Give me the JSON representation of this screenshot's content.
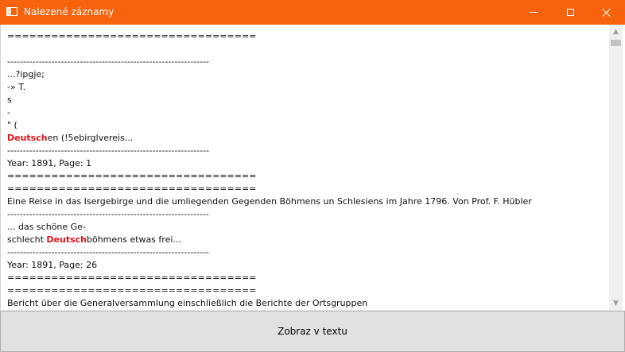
{
  "window": {
    "title": "Nalezené záznamy",
    "colors": {
      "titlebar": "#f7630c",
      "highlight": "#e8141c"
    },
    "controls": {
      "minimize": "minimize-icon",
      "maximize": "maximize-icon",
      "close": "close-icon"
    }
  },
  "results": {
    "lines": [
      {
        "text": "=================================="
      },
      {
        "text": ""
      },
      {
        "text": "----------------------------------------------------------------"
      },
      {
        "text": "...?ipgje;"
      },
      {
        "text": "-» T."
      },
      {
        "text": "s"
      },
      {
        "text": "-"
      },
      {
        "text": "\" ("
      },
      {
        "hl": "Deutsch",
        "text": "en (!5ebirglvereis..."
      },
      {
        "text": "----------------------------------------------------------------"
      },
      {
        "text": "Year: 1891, Page: 1"
      },
      {
        "text": "=================================="
      },
      {
        "text": "=================================="
      },
      {
        "text": "Eine Reise in das Isergebirge und die umliegenden Gegenden Böhmens un Schlesiens im Jahre 1796. Von Prof. F. Hübler"
      },
      {
        "text": "----------------------------------------------------------------"
      },
      {
        "text": "... das schöne Ge-"
      },
      {
        "pre": "schlecht ",
        "hl": "Deutsch",
        "text": "böhmens etwas frei..."
      },
      {
        "text": "----------------------------------------------------------------"
      },
      {
        "text": "Year: 1891, Page: 26"
      },
      {
        "text": "=================================="
      },
      {
        "text": "=================================="
      },
      {
        "text": "Bericht über die Generalversammlung einschließlich die Berichte der Ortsgruppen"
      }
    ]
  },
  "scrollbar": {
    "position": 0.01
  },
  "action_button": {
    "label": "Zobraz v textu"
  }
}
